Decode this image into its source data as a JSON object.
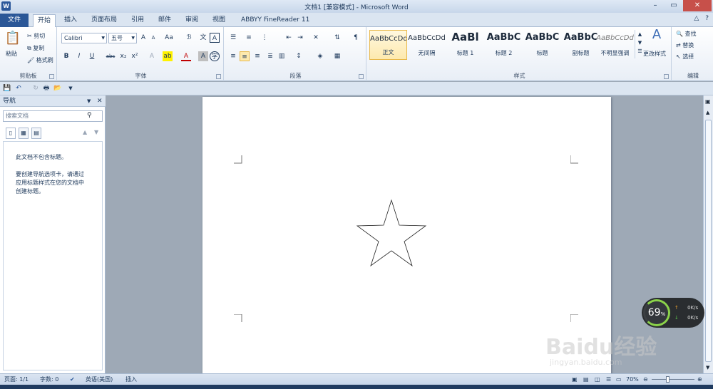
{
  "window": {
    "title": "文档1 [兼容模式] - Microsoft Word",
    "app_icon": "W"
  },
  "ribbon_tabs": [
    {
      "label": "文件"
    },
    {
      "label": "开始"
    },
    {
      "label": "插入"
    },
    {
      "label": "页面布局"
    },
    {
      "label": "引用"
    },
    {
      "label": "邮件"
    },
    {
      "label": "审阅"
    },
    {
      "label": "视图"
    },
    {
      "label": "ABBYY FineReader 11"
    }
  ],
  "clipboard": {
    "paste": "粘贴",
    "cut": "剪切",
    "copy": "复制",
    "format_painter": "格式刷",
    "group_label": "剪贴板"
  },
  "font": {
    "name": "Calibri",
    "size": "五号",
    "group_label": "字体",
    "aa": "Aa",
    "bold": "B",
    "italic": "I",
    "underline": "U",
    "strike": "abc",
    "sub": "x₂",
    "sup": "x²",
    "grow": "A",
    "shrink": "A"
  },
  "paragraph": {
    "group_label": "段落"
  },
  "styles": {
    "group_label": "样式",
    "items": [
      {
        "sample": "AaBbCcDd",
        "name": "正文"
      },
      {
        "sample": "AaBbCcDd",
        "name": "无间隔"
      },
      {
        "sample": "AaBl",
        "name": "标题 1"
      },
      {
        "sample": "AaBbC",
        "name": "标题 2"
      },
      {
        "sample": "AaBbC",
        "name": "标题"
      },
      {
        "sample": "AaBbC",
        "name": "副标题"
      },
      {
        "sample": "AaBbCcDd",
        "name": "不明显强调"
      }
    ],
    "change_styles": "更改样式"
  },
  "editing": {
    "find": "查找",
    "replace": "替换",
    "select": "选择",
    "group_label": "编辑"
  },
  "nav_pane": {
    "title": "导航",
    "search_placeholder": "搜索文档",
    "msg1": "此文档不包含标题。",
    "msg2_line1": "要创建导航选项卡，请通过",
    "msg2_line2": "应用标题样式在您的文档中",
    "msg2_line3": "创建标题。"
  },
  "status": {
    "page": "页面: 1/1",
    "words": "字数: 0",
    "language": "英语(美国)",
    "mode": "插入",
    "zoom": "70%"
  },
  "widget": {
    "percent": "69",
    "percent_sign": "%",
    "up": "0K/s",
    "down": "0K/s"
  },
  "watermark": {
    "brand": "Baidu经验",
    "url": "jingyan.baidu.com"
  }
}
